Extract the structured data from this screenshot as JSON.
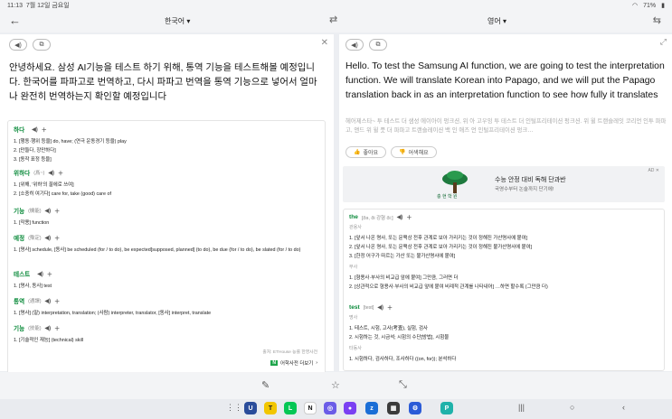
{
  "status": {
    "time": "11:13",
    "date": "7월 12일 금요일",
    "battery": "71%"
  },
  "topbar": {
    "source_lang": "한국어",
    "target_lang": "영어"
  },
  "source": {
    "text": "안녕하세요. 삼성 AI기능을 테스트 하기 위해, 통역 기능을 테스트해볼 예정입니다. 한국어를 파파고로 번역하고, 다시 파파고 번역을 통역 기능으로 넣어서 얼마나 완전히 번역하는지 확인할 예정입니다"
  },
  "target": {
    "text": "Hello. To test the Samsung AI function, we are going to test the interpretation function. We will translate Korean into Papago, and we will put the Papago translation back in as an interpretation function to see how fully it translates",
    "pronunciation": "헤어제스타~ 투 테스트 더 샘성 에이아이 펑크션, 위 아 고우잉 투 테스트 더 인털프리테이션 펑크션. 위 윌 트랜슬레잇 코리언 인투 파파고, 앤드 위 윌 풋 더 파파고 트랜슬레이션 백 인 애즈 언 인털프리테이션 펑크…",
    "like_label": "좋아요",
    "dislike_label": "어색해요"
  },
  "ad": {
    "badge": "AD ✕",
    "logo_text": "충 현 학 원",
    "title": "수능 안정 대비 독해 단과반",
    "subtitle": "국영수부터 논술까지 단기에!"
  },
  "dict_left": [
    {
      "word": "하다",
      "pos": "",
      "defs": [
        "1. [행동·행위 등을] do, have; (연극 운동경기 등을) play",
        "2. [만들다, 장만하다]",
        "3. [동작 표정 등을]"
      ]
    },
    {
      "word": "위하다",
      "pos": "(爲~)",
      "defs": [
        "1. [위해, '위하'의 꼴에로 쓰여]",
        "2. [소중히 여기다] care for, take (good) care of"
      ]
    },
    {
      "word": "기능",
      "pos": "(機能)",
      "defs": [
        "1. [작용] function"
      ]
    },
    {
      "word": "예정",
      "pos": "(豫定)",
      "defs": [
        "1. [명사] schedule, [동사] be scheduled (for / to do), be expected[supposed, planned] (to do), be due (for / to do), be slated (for / to do)"
      ]
    },
    {
      "word": "테스트",
      "pos": "",
      "defs": [
        "1. [명사, 동사] test"
      ]
    },
    {
      "word": "통역",
      "pos": "(通譯)",
      "defs": [
        "1. [명사] (말) interpretation, translation; (사람) interpreter, translator, [동사] interpret, translate"
      ]
    },
    {
      "word": "기능",
      "pos": "(技能)",
      "defs": [
        "1. [기술적인 재능] (technical) skill"
      ]
    }
  ],
  "dict_left_source": "출처: ETHouse 능률 한영사전",
  "dict_left_more": "어학사전 더보기",
  "dict_left_more_badge": "N",
  "dict_right": [
    {
      "word": "the",
      "pos": "[ðə, ði 강형 ðiː]",
      "cat": "관용사",
      "defs": [
        "1. [앞서 나온 명사, 또는 문맥상 전후 관계로 보아 가리키는 것이 정해진 가산명사에 붙여]",
        "2. [앞서 나온 명사, 또는 문맥상 전후 관계로 보아 가리키는 것이 정해진 불가산명사에 붙여]",
        "3. [한정 어구가 따르는 가산 또는 불가산명사에 붙여]"
      ],
      "cat2": "부사",
      "defs2": [
        "1. [형용사·부사의 비교급 앞에 붙여] 그만큼, 그러면 더",
        "2. [상관적으로 형용사·부사의 비교급 앞에 붙여 비례적 관계를 나타내어] …하면 할수록 (그만큼 더)"
      ]
    },
    {
      "word": "test",
      "pos": "[test]",
      "cat": "명사",
      "defs": [
        "1. 테스트, 시험, 고사(考査), 실험, 검사",
        "2. 시험하는 것, 시금석; 시험의 수단[방법], 시험물"
      ],
      "cat2": "타동사",
      "defs2": [
        "1. 시험하다, 검사하다, 조사하다 ((on, for)); 분석하다"
      ]
    }
  ]
}
